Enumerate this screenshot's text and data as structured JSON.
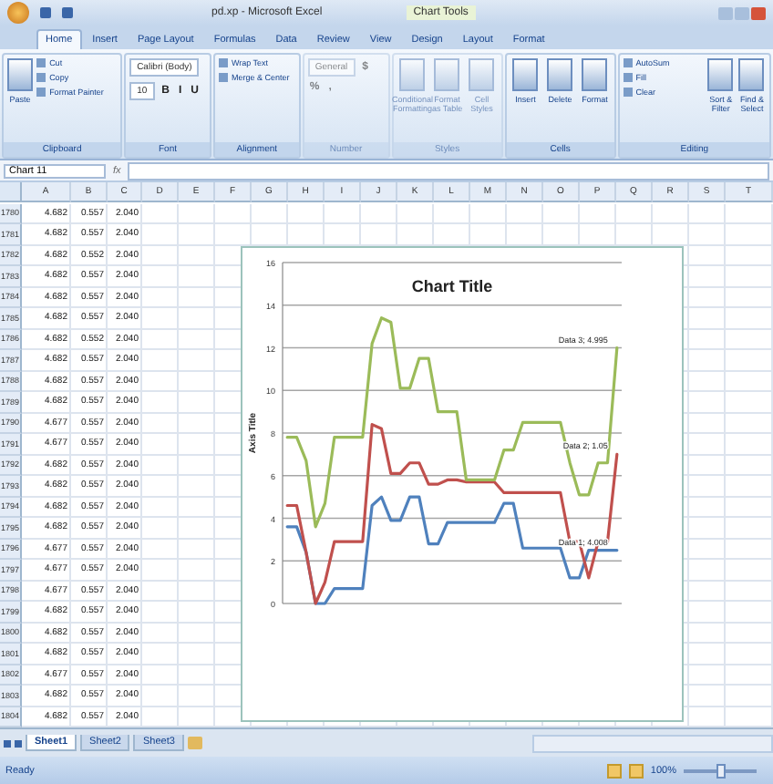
{
  "window": {
    "title": "pd.xp - Microsoft Excel",
    "context_tab": "Chart Tools"
  },
  "tabs": [
    {
      "label": "Home",
      "selected": true
    },
    {
      "label": "Insert",
      "selected": false
    },
    {
      "label": "Page Layout",
      "selected": false
    },
    {
      "label": "Formulas",
      "selected": false
    },
    {
      "label": "Data",
      "selected": false
    },
    {
      "label": "Review",
      "selected": false
    },
    {
      "label": "View",
      "selected": false
    },
    {
      "label": "Design",
      "selected": false
    },
    {
      "label": "Layout",
      "selected": false
    },
    {
      "label": "Format",
      "selected": false
    }
  ],
  "ribbon": [
    {
      "label": "Clipboard",
      "disabled": false,
      "items": [
        {
          "kind": "large",
          "label": "Paste"
        },
        {
          "kind": "small",
          "label": "Cut"
        },
        {
          "kind": "small",
          "label": "Copy"
        },
        {
          "kind": "small",
          "label": "Format Painter"
        }
      ]
    },
    {
      "label": "Font",
      "disabled": false,
      "items": [
        {
          "kind": "field",
          "label": "Calibri (Body)"
        },
        {
          "kind": "field",
          "label": "10"
        },
        {
          "kind": "glyph",
          "label": "B"
        },
        {
          "kind": "glyph",
          "label": "I"
        },
        {
          "kind": "glyph",
          "label": "U"
        }
      ]
    },
    {
      "label": "Alignment",
      "disabled": false,
      "items": [
        {
          "kind": "small",
          "label": "Wrap Text"
        },
        {
          "kind": "small",
          "label": "Merge & Center"
        }
      ]
    },
    {
      "label": "Number",
      "disabled": true,
      "items": [
        {
          "kind": "field",
          "label": "General"
        },
        {
          "kind": "glyph",
          "label": "$"
        },
        {
          "kind": "glyph",
          "label": "%"
        },
        {
          "kind": "glyph",
          "label": ","
        }
      ]
    },
    {
      "label": "Styles",
      "disabled": true,
      "items": [
        {
          "kind": "large",
          "label": "Conditional Formatting"
        },
        {
          "kind": "large",
          "label": "Format as Table"
        },
        {
          "kind": "large",
          "label": "Cell Styles"
        }
      ]
    },
    {
      "label": "Cells",
      "disabled": false,
      "items": [
        {
          "kind": "large",
          "label": "Insert"
        },
        {
          "kind": "large",
          "label": "Delete"
        },
        {
          "kind": "large",
          "label": "Format"
        }
      ]
    },
    {
      "label": "Editing",
      "disabled": false,
      "items": [
        {
          "kind": "small",
          "label": "AutoSum"
        },
        {
          "kind": "small",
          "label": "Fill"
        },
        {
          "kind": "small",
          "label": "Clear"
        },
        {
          "kind": "large",
          "label": "Sort & Filter"
        },
        {
          "kind": "large",
          "label": "Find & Select"
        }
      ]
    }
  ],
  "formula_bar": {
    "name_box": "Chart 11",
    "fx": "fx"
  },
  "columns": [
    "A",
    "B",
    "C",
    "D",
    "E",
    "F",
    "G",
    "H",
    "I",
    "J",
    "K",
    "L",
    "M",
    "N",
    "O",
    "P",
    "Q",
    "R",
    "S",
    "T"
  ],
  "rows": [
    {
      "n": "1780",
      "a": "4.682",
      "b": "0.557",
      "c": "2.040"
    },
    {
      "n": "1781",
      "a": "4.682",
      "b": "0.557",
      "c": "2.040"
    },
    {
      "n": "1782",
      "a": "4.682",
      "b": "0.552",
      "c": "2.040"
    },
    {
      "n": "1783",
      "a": "4.682",
      "b": "0.557",
      "c": "2.040"
    },
    {
      "n": "1784",
      "a": "4.682",
      "b": "0.557",
      "c": "2.040"
    },
    {
      "n": "1785",
      "a": "4.682",
      "b": "0.557",
      "c": "2.040"
    },
    {
      "n": "1786",
      "a": "4.682",
      "b": "0.552",
      "c": "2.040"
    },
    {
      "n": "1787",
      "a": "4.682",
      "b": "0.557",
      "c": "2.040"
    },
    {
      "n": "1788",
      "a": "4.682",
      "b": "0.557",
      "c": "2.040"
    },
    {
      "n": "1789",
      "a": "4.682",
      "b": "0.557",
      "c": "2.040"
    },
    {
      "n": "1790",
      "a": "4.677",
      "b": "0.557",
      "c": "2.040"
    },
    {
      "n": "1791",
      "a": "4.677",
      "b": "0.557",
      "c": "2.040"
    },
    {
      "n": "1792",
      "a": "4.682",
      "b": "0.557",
      "c": "2.040"
    },
    {
      "n": "1793",
      "a": "4.682",
      "b": "0.557",
      "c": "2.040"
    },
    {
      "n": "1794",
      "a": "4.682",
      "b": "0.557",
      "c": "2.040"
    },
    {
      "n": "1795",
      "a": "4.682",
      "b": "0.557",
      "c": "2.040"
    },
    {
      "n": "1796",
      "a": "4.677",
      "b": "0.557",
      "c": "2.040"
    },
    {
      "n": "1797",
      "a": "4.677",
      "b": "0.557",
      "c": "2.040"
    },
    {
      "n": "1798",
      "a": "4.677",
      "b": "0.557",
      "c": "2.040"
    },
    {
      "n": "1799",
      "a": "4.682",
      "b": "0.557",
      "c": "2.040"
    },
    {
      "n": "1800",
      "a": "4.682",
      "b": "0.557",
      "c": "2.040"
    },
    {
      "n": "1801",
      "a": "4.682",
      "b": "0.557",
      "c": "2.040"
    },
    {
      "n": "1802",
      "a": "4.677",
      "b": "0.557",
      "c": "2.040"
    },
    {
      "n": "1803",
      "a": "4.682",
      "b": "0.557",
      "c": "2.040"
    },
    {
      "n": "1804",
      "a": "4.682",
      "b": "0.557",
      "c": "2.040"
    }
  ],
  "chart": {
    "chart_data": {
      "type": "line",
      "title": "Chart Title",
      "ylabel": "Axis Title",
      "ylim": [
        0,
        16
      ],
      "yticks": [
        0,
        2,
        4,
        6,
        8,
        10,
        12,
        14,
        16
      ],
      "series": [
        {
          "name": "Data 1",
          "color": "#4f81bd",
          "values": [
            3.6,
            3.6,
            2.4,
            0,
            0,
            0.7,
            0.7,
            0.7,
            0.7,
            4.6,
            5.0,
            3.9,
            3.9,
            5.0,
            5.0,
            2.8,
            2.8,
            3.8,
            3.8,
            3.8,
            3.8,
            3.8,
            3.8,
            4.7,
            4.7,
            2.6,
            2.6,
            2.6,
            2.6,
            2.6,
            1.2,
            1.2,
            2.5,
            2.5,
            2.5,
            2.5
          ]
        },
        {
          "name": "Data 2",
          "color": "#c0504d",
          "values": [
            4.6,
            4.6,
            2.4,
            0,
            1.0,
            2.9,
            2.9,
            2.9,
            2.9,
            8.4,
            8.2,
            6.1,
            6.1,
            6.6,
            6.6,
            5.6,
            5.6,
            5.8,
            5.8,
            5.7,
            5.7,
            5.7,
            5.7,
            5.2,
            5.2,
            5.2,
            5.2,
            5.2,
            5.2,
            5.2,
            2.9,
            2.9,
            1.2,
            2.9,
            2.9,
            7.0
          ]
        },
        {
          "name": "Data 3",
          "color": "#9bbb59",
          "values": [
            7.8,
            7.8,
            6.7,
            3.6,
            4.7,
            7.8,
            7.8,
            7.8,
            7.8,
            12.2,
            13.4,
            13.2,
            10.1,
            10.1,
            11.5,
            11.5,
            9.0,
            9.0,
            9.0,
            5.8,
            5.8,
            5.8,
            5.8,
            7.2,
            7.2,
            8.5,
            8.5,
            8.5,
            8.5,
            8.5,
            6.6,
            5.1,
            5.1,
            6.6,
            6.6,
            12.0
          ]
        }
      ],
      "grid": true,
      "annotations": [
        {
          "text": "; 4.008"
        },
        {
          "text": "; 1.05"
        },
        {
          "text": "; 4.995"
        }
      ]
    }
  },
  "sheet_tabs": [
    {
      "label": "Sheet1",
      "selected": true
    },
    {
      "label": "Sheet2",
      "selected": false
    },
    {
      "label": "Sheet3",
      "selected": false
    }
  ],
  "status_bar": {
    "text": "Ready",
    "zoom": "100%",
    "zoom_slider": {
      "level": 0.5
    }
  }
}
